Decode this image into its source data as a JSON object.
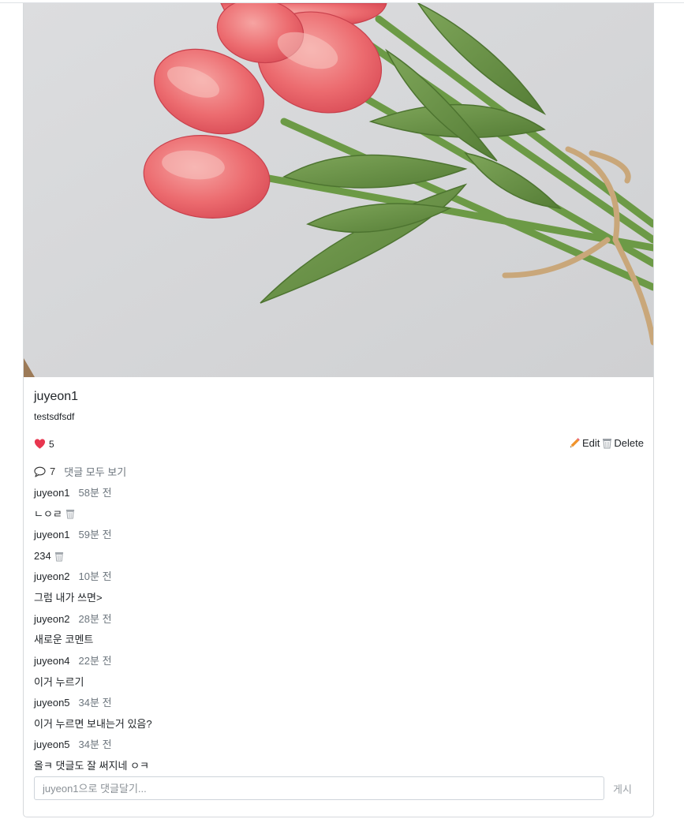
{
  "post": {
    "image_alt": "pink tulip bouquet",
    "author": "juyeon1",
    "content": "testsdfsdf",
    "likes": "5",
    "edit_label": "Edit",
    "delete_label": "Delete",
    "comment_count": "7",
    "view_all_label": "댓글 모두 보기"
  },
  "comments": [
    {
      "author": "juyeon1",
      "time": "58분 전",
      "text": "ㄴㅇㄹ",
      "deletable": true
    },
    {
      "author": "juyeon1",
      "time": "59분 전",
      "text": "234",
      "deletable": true
    },
    {
      "author": "juyeon2",
      "time": "10분 전",
      "text": "그럼 내가 쓰면>",
      "deletable": false
    },
    {
      "author": "juyeon2",
      "time": "28분 전",
      "text": "새로운 코멘트",
      "deletable": false
    },
    {
      "author": "juyeon4",
      "time": "22분 전",
      "text": "이거 누르기",
      "deletable": false
    },
    {
      "author": "juyeon5",
      "time": "34분 전",
      "text": "이거 누르면 보내는거 있음?",
      "deletable": false
    },
    {
      "author": "juyeon5",
      "time": "34분 전",
      "text": "올ㅋ 댓글도 잘 써지네 ㅇㅋ",
      "deletable": false
    }
  ],
  "comment_form": {
    "placeholder": "juyeon1으로 댓글달기...",
    "submit_label": "게시"
  },
  "colors": {
    "heart": "#e8364f",
    "pencil": "#f0932b",
    "muted": "#6c757d"
  }
}
